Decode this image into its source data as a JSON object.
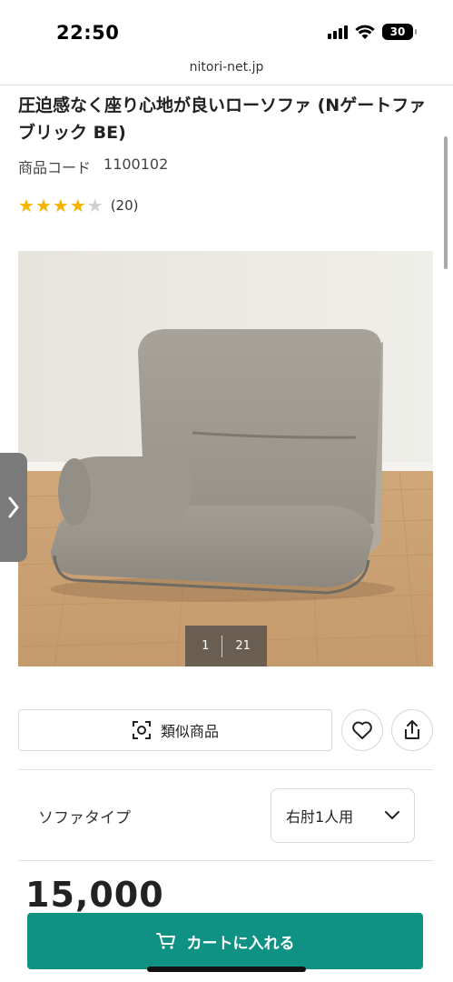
{
  "status_bar": {
    "time": "22:50",
    "battery": "30"
  },
  "browser": {
    "url": "nitori-net.jp"
  },
  "product": {
    "title": "圧迫感なく座り心地が良いローソファ (Nゲートファブリック BE)",
    "code_label": "商品コード",
    "code_value": "1100102",
    "rating": {
      "stars": 4,
      "max_stars": 5,
      "count_text": "(20)"
    },
    "image": {
      "current": "1",
      "total": "21"
    }
  },
  "actions": {
    "similar_label": "類似商品",
    "favorite_icon": "heart-icon",
    "share_icon": "share-icon"
  },
  "options": {
    "type_label": "ソファタイプ",
    "type_value": "右肘1人用"
  },
  "price": {
    "amount": "15,000"
  },
  "cart": {
    "label": "カートに入れる"
  },
  "colors": {
    "accent": "#0f9283",
    "star": "#f5b400"
  }
}
